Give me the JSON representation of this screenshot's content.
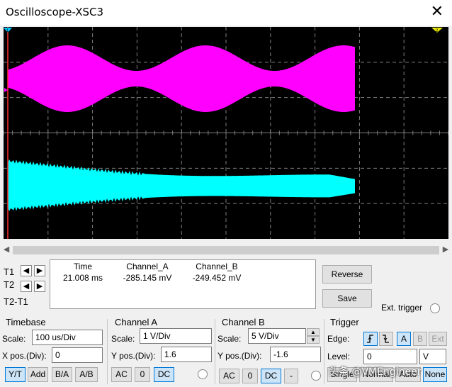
{
  "window": {
    "title": "Oscilloscope-XSC3",
    "close_glyph": "✕"
  },
  "screen": {
    "channel_a_color": "#ff00ff",
    "channel_b_color": "#00ffff",
    "cursor1_color": "#ff3030",
    "grid_color": "#7f7f7f",
    "cursor_flag_1": "1",
    "cursor_flag_2": "2"
  },
  "cursors": {
    "t1_label": "T1",
    "t2_label": "T2",
    "diff_label": "T2-T1"
  },
  "readout": {
    "headers": [
      "Time",
      "Channel_A",
      "Channel_B"
    ],
    "values": [
      "21.008 ms",
      "-285.145 mV",
      "-249.452 mV"
    ]
  },
  "actions": {
    "reverse": "Reverse",
    "save": "Save",
    "ext_trigger": "Ext. trigger"
  },
  "timebase": {
    "title": "Timebase",
    "scale_label": "Scale:",
    "scale_value": "100 us/Div",
    "xpos_label": "X pos.(Div):",
    "xpos_value": "0",
    "modes": [
      "Y/T",
      "Add",
      "B/A",
      "A/B"
    ]
  },
  "channel_a": {
    "title": "Channel A",
    "scale_label": "Scale:",
    "scale_value": "1  V/Div",
    "ypos_label": "Y pos.(Div):",
    "ypos_value": "1.6",
    "couplings": [
      "AC",
      "0",
      "DC"
    ]
  },
  "channel_b": {
    "title": "Channel B",
    "scale_label": "Scale:",
    "scale_value": "5  V/Div",
    "ypos_label": "Y pos.(Div):",
    "ypos_value": "-1.6",
    "couplings": [
      "AC",
      "0",
      "DC",
      "-"
    ]
  },
  "trigger": {
    "title": "Trigger",
    "edge_label": "Edge:",
    "edge_buttons": [
      "A",
      "B",
      "Ext"
    ],
    "level_label": "Level:",
    "level_value": "0",
    "level_unit": "V",
    "modes": [
      "Single",
      "Normal",
      "Auto",
      "None"
    ]
  },
  "watermark": "头条 @VMEngineer"
}
